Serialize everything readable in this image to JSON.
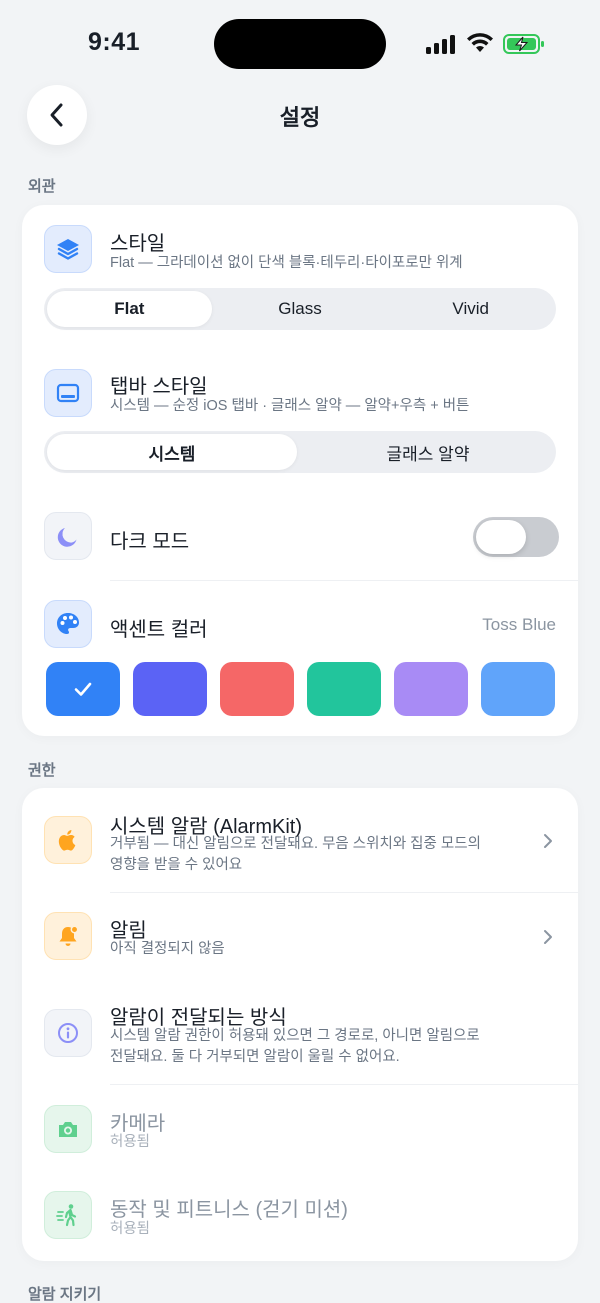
{
  "status_bar": {
    "time": "9:41"
  },
  "nav": {
    "title": "설정"
  },
  "sections": {
    "appearance": "외관",
    "permissions": "권한",
    "alarm_keep": "알람 지키기"
  },
  "appearance": {
    "style": {
      "title": "스타일",
      "subtitle": "Flat — 그라데이션 없이 단색 블록·테두리·타이포로만 위계",
      "options": [
        "Flat",
        "Glass",
        "Vivid"
      ],
      "selected": "Flat"
    },
    "tabbar": {
      "title": "탭바 스타일",
      "subtitle": "시스템 — 순정 iOS 탭바 · 글래스 알약 — 알약+우측 + 버튼",
      "options": [
        "시스템",
        "글래스 알약"
      ],
      "selected": "시스템"
    },
    "dark_mode": {
      "title": "다크 모드",
      "enabled": false
    },
    "accent": {
      "title": "액센트 컬러",
      "value": "Toss Blue",
      "swatches": [
        "#3182f6",
        "#5b63f5",
        "#f56767",
        "#22c59c",
        "#a88bf5",
        "#60a4fa"
      ],
      "selected_index": 0
    }
  },
  "permissions": {
    "items": [
      {
        "title": "시스템 알람 (AlarmKit)",
        "subtitle_line1": "거부됨 — 대신 알림으로 전달돼요. 무음 스위치와 집중 모드의",
        "subtitle_line2": "영향을 받을 수 있어요",
        "icon": "apple-icon"
      },
      {
        "title": "알림",
        "subtitle_line1": "아직 결정되지 않음",
        "icon": "bell-icon"
      },
      {
        "title": "알람이 전달되는 방식",
        "subtitle_line1": "시스템 알람 권한이 허용돼 있으면 그 경로로, 아니면 알림으로",
        "subtitle_line2": "전달돼요. 둘 다 거부되면 알람이 울릴 수 없어요.",
        "icon": "info-icon"
      },
      {
        "title": "카메라",
        "subtitle_line1": "허용됨",
        "icon": "camera-icon"
      },
      {
        "title": "동작 및 피트니스 (걷기 미션)",
        "subtitle_line1": "허용됨",
        "icon": "walking-icon"
      }
    ]
  },
  "colors": {
    "accent": "#3182f6",
    "background": "#f2f4f6",
    "card": "#ffffff"
  }
}
